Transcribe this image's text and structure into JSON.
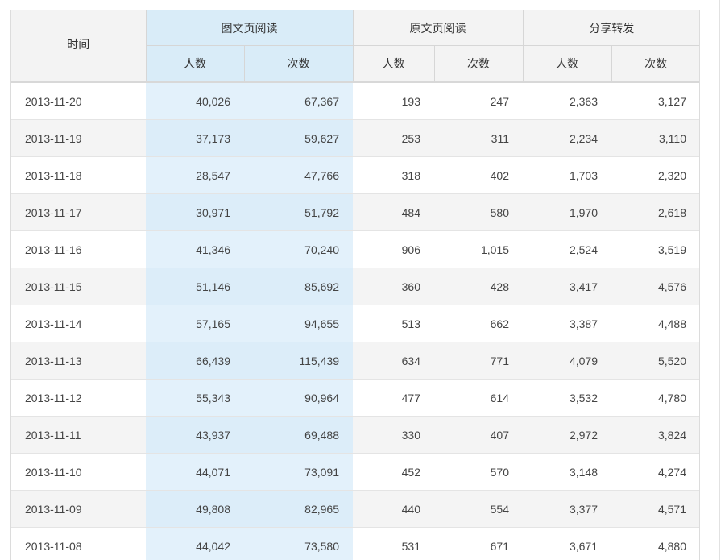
{
  "table": {
    "header": {
      "time": "时间",
      "groups": [
        {
          "label": "图文页阅读",
          "sub": [
            "人数",
            "次数"
          ]
        },
        {
          "label": "原文页阅读",
          "sub": [
            "人数",
            "次数"
          ]
        },
        {
          "label": "分享转发",
          "sub": [
            "人数",
            "次数"
          ]
        }
      ]
    },
    "rows": [
      {
        "date": "2013-11-20",
        "values": [
          "40,026",
          "67,367",
          "193",
          "247",
          "2,363",
          "3,127"
        ]
      },
      {
        "date": "2013-11-19",
        "values": [
          "37,173",
          "59,627",
          "253",
          "311",
          "2,234",
          "3,110"
        ]
      },
      {
        "date": "2013-11-18",
        "values": [
          "28,547",
          "47,766",
          "318",
          "402",
          "1,703",
          "2,320"
        ]
      },
      {
        "date": "2013-11-17",
        "values": [
          "30,971",
          "51,792",
          "484",
          "580",
          "1,970",
          "2,618"
        ]
      },
      {
        "date": "2013-11-16",
        "values": [
          "41,346",
          "70,240",
          "906",
          "1,015",
          "2,524",
          "3,519"
        ]
      },
      {
        "date": "2013-11-15",
        "values": [
          "51,146",
          "85,692",
          "360",
          "428",
          "3,417",
          "4,576"
        ]
      },
      {
        "date": "2013-11-14",
        "values": [
          "57,165",
          "94,655",
          "513",
          "662",
          "3,387",
          "4,488"
        ]
      },
      {
        "date": "2013-11-13",
        "values": [
          "66,439",
          "115,439",
          "634",
          "771",
          "4,079",
          "5,520"
        ]
      },
      {
        "date": "2013-11-12",
        "values": [
          "55,343",
          "90,964",
          "477",
          "614",
          "3,532",
          "4,780"
        ]
      },
      {
        "date": "2013-11-11",
        "values": [
          "43,937",
          "69,488",
          "330",
          "407",
          "2,972",
          "3,824"
        ]
      },
      {
        "date": "2013-11-10",
        "values": [
          "44,071",
          "73,091",
          "452",
          "570",
          "3,148",
          "4,274"
        ]
      },
      {
        "date": "2013-11-09",
        "values": [
          "49,808",
          "82,965",
          "440",
          "554",
          "3,377",
          "4,571"
        ]
      },
      {
        "date": "2013-11-08",
        "values": [
          "44,042",
          "73,580",
          "531",
          "671",
          "3,671",
          "4,880"
        ]
      }
    ]
  },
  "colors": {
    "highlight_column": "#d9ecf8",
    "header_background": "#f3f3f3",
    "zebra_row": "#f4f4f4"
  }
}
